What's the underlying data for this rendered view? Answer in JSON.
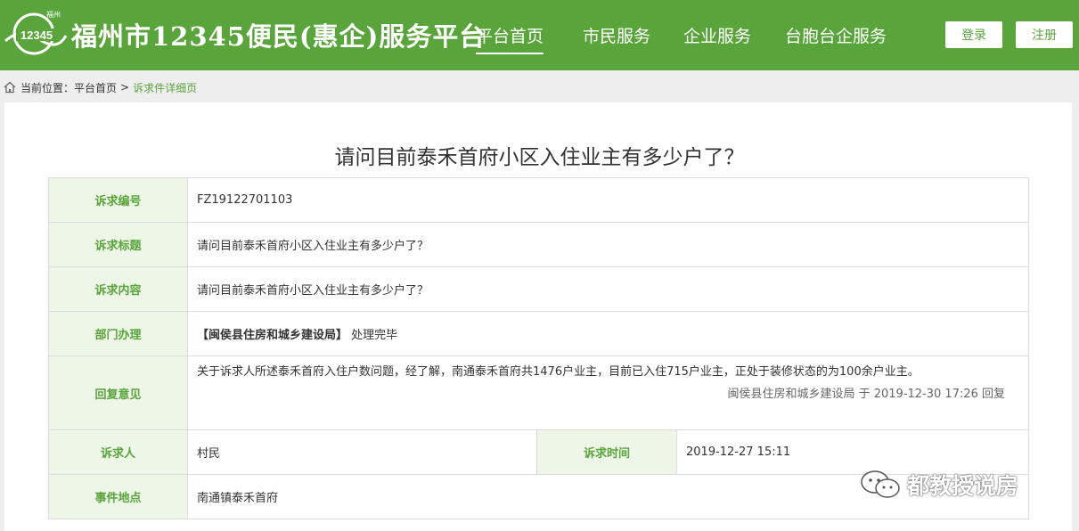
{
  "header": {
    "logo_small_text": "福州",
    "logo_number": "12345",
    "site_title": "福州市12345便民(惠企)服务平台",
    "nav": [
      {
        "label": "平台首页",
        "active": true
      },
      {
        "label": "市民服务",
        "active": false
      },
      {
        "label": "企业服务",
        "active": false
      },
      {
        "label": "台胞台企服务",
        "active": false
      }
    ],
    "login_label": "登录",
    "register_label": "注册"
  },
  "breadcrumb": {
    "prefix": "当前位置：",
    "home": "平台首页",
    "separator": ">",
    "current": "诉求件详细页"
  },
  "detail": {
    "title": "请问目前泰禾首府小区入住业主有多少户了？",
    "rows": {
      "id_label": "诉求编号",
      "id_value": "FZ19122701103",
      "subject_label": "诉求标题",
      "subject_value": "请问目前泰禾首府小区入住业主有多少户了？",
      "content_label": "诉求内容",
      "content_value": "请问目前泰禾首府小区入住业主有多少户了？",
      "dept_label": "部门办理",
      "dept_name": "【闽侯县住房和城乡建设局】",
      "dept_status": "处理完毕",
      "reply_label": "回复意见",
      "reply_text": "关于诉求人所述泰禾首府入住户数问题，经了解，南通泰禾首府共1476户业主，目前已入住715户业主，正处于装修状态的为100余户业主。",
      "reply_signature": "闽侯县住房和城乡建设局 于 2019-12-30 17:26 回复",
      "requester_label": "诉求人",
      "requester_value": "村民",
      "time_label": "诉求时间",
      "time_value": "2019-12-27 15:11",
      "location_label": "事件地点",
      "location_value": "南通镇泰禾首府"
    }
  },
  "watermark": {
    "text": "都教授说房",
    "icon": "wechat-icon"
  },
  "colors": {
    "brand_green": "#5aa43c",
    "label_bg": "#eef6e7",
    "border": "#dcdcdc",
    "page_bg": "#eeeeee"
  }
}
